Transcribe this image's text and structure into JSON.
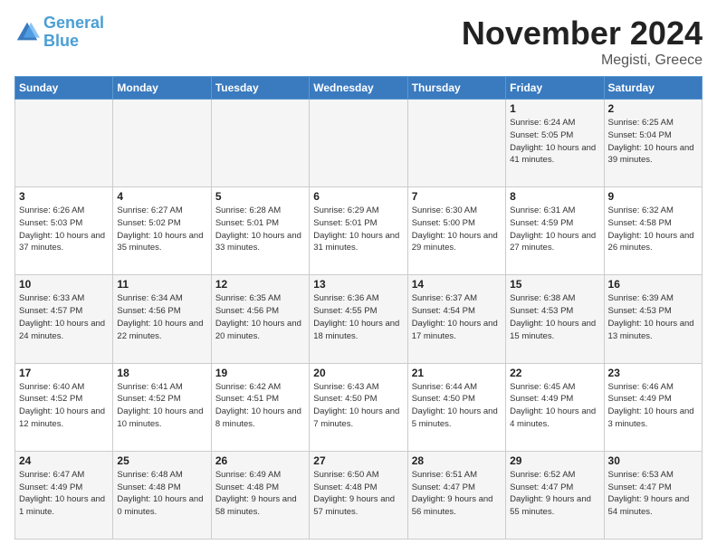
{
  "header": {
    "logo_general": "General",
    "logo_blue": "Blue",
    "month_title": "November 2024",
    "location": "Megisti, Greece"
  },
  "days_of_week": [
    "Sunday",
    "Monday",
    "Tuesday",
    "Wednesday",
    "Thursday",
    "Friday",
    "Saturday"
  ],
  "weeks": [
    [
      {
        "day": "",
        "info": ""
      },
      {
        "day": "",
        "info": ""
      },
      {
        "day": "",
        "info": ""
      },
      {
        "day": "",
        "info": ""
      },
      {
        "day": "",
        "info": ""
      },
      {
        "day": "1",
        "info": "Sunrise: 6:24 AM\nSunset: 5:05 PM\nDaylight: 10 hours and 41 minutes."
      },
      {
        "day": "2",
        "info": "Sunrise: 6:25 AM\nSunset: 5:04 PM\nDaylight: 10 hours and 39 minutes."
      }
    ],
    [
      {
        "day": "3",
        "info": "Sunrise: 6:26 AM\nSunset: 5:03 PM\nDaylight: 10 hours and 37 minutes."
      },
      {
        "day": "4",
        "info": "Sunrise: 6:27 AM\nSunset: 5:02 PM\nDaylight: 10 hours and 35 minutes."
      },
      {
        "day": "5",
        "info": "Sunrise: 6:28 AM\nSunset: 5:01 PM\nDaylight: 10 hours and 33 minutes."
      },
      {
        "day": "6",
        "info": "Sunrise: 6:29 AM\nSunset: 5:01 PM\nDaylight: 10 hours and 31 minutes."
      },
      {
        "day": "7",
        "info": "Sunrise: 6:30 AM\nSunset: 5:00 PM\nDaylight: 10 hours and 29 minutes."
      },
      {
        "day": "8",
        "info": "Sunrise: 6:31 AM\nSunset: 4:59 PM\nDaylight: 10 hours and 27 minutes."
      },
      {
        "day": "9",
        "info": "Sunrise: 6:32 AM\nSunset: 4:58 PM\nDaylight: 10 hours and 26 minutes."
      }
    ],
    [
      {
        "day": "10",
        "info": "Sunrise: 6:33 AM\nSunset: 4:57 PM\nDaylight: 10 hours and 24 minutes."
      },
      {
        "day": "11",
        "info": "Sunrise: 6:34 AM\nSunset: 4:56 PM\nDaylight: 10 hours and 22 minutes."
      },
      {
        "day": "12",
        "info": "Sunrise: 6:35 AM\nSunset: 4:56 PM\nDaylight: 10 hours and 20 minutes."
      },
      {
        "day": "13",
        "info": "Sunrise: 6:36 AM\nSunset: 4:55 PM\nDaylight: 10 hours and 18 minutes."
      },
      {
        "day": "14",
        "info": "Sunrise: 6:37 AM\nSunset: 4:54 PM\nDaylight: 10 hours and 17 minutes."
      },
      {
        "day": "15",
        "info": "Sunrise: 6:38 AM\nSunset: 4:53 PM\nDaylight: 10 hours and 15 minutes."
      },
      {
        "day": "16",
        "info": "Sunrise: 6:39 AM\nSunset: 4:53 PM\nDaylight: 10 hours and 13 minutes."
      }
    ],
    [
      {
        "day": "17",
        "info": "Sunrise: 6:40 AM\nSunset: 4:52 PM\nDaylight: 10 hours and 12 minutes."
      },
      {
        "day": "18",
        "info": "Sunrise: 6:41 AM\nSunset: 4:52 PM\nDaylight: 10 hours and 10 minutes."
      },
      {
        "day": "19",
        "info": "Sunrise: 6:42 AM\nSunset: 4:51 PM\nDaylight: 10 hours and 8 minutes."
      },
      {
        "day": "20",
        "info": "Sunrise: 6:43 AM\nSunset: 4:50 PM\nDaylight: 10 hours and 7 minutes."
      },
      {
        "day": "21",
        "info": "Sunrise: 6:44 AM\nSunset: 4:50 PM\nDaylight: 10 hours and 5 minutes."
      },
      {
        "day": "22",
        "info": "Sunrise: 6:45 AM\nSunset: 4:49 PM\nDaylight: 10 hours and 4 minutes."
      },
      {
        "day": "23",
        "info": "Sunrise: 6:46 AM\nSunset: 4:49 PM\nDaylight: 10 hours and 3 minutes."
      }
    ],
    [
      {
        "day": "24",
        "info": "Sunrise: 6:47 AM\nSunset: 4:49 PM\nDaylight: 10 hours and 1 minute."
      },
      {
        "day": "25",
        "info": "Sunrise: 6:48 AM\nSunset: 4:48 PM\nDaylight: 10 hours and 0 minutes."
      },
      {
        "day": "26",
        "info": "Sunrise: 6:49 AM\nSunset: 4:48 PM\nDaylight: 9 hours and 58 minutes."
      },
      {
        "day": "27",
        "info": "Sunrise: 6:50 AM\nSunset: 4:48 PM\nDaylight: 9 hours and 57 minutes."
      },
      {
        "day": "28",
        "info": "Sunrise: 6:51 AM\nSunset: 4:47 PM\nDaylight: 9 hours and 56 minutes."
      },
      {
        "day": "29",
        "info": "Sunrise: 6:52 AM\nSunset: 4:47 PM\nDaylight: 9 hours and 55 minutes."
      },
      {
        "day": "30",
        "info": "Sunrise: 6:53 AM\nSunset: 4:47 PM\nDaylight: 9 hours and 54 minutes."
      }
    ]
  ]
}
